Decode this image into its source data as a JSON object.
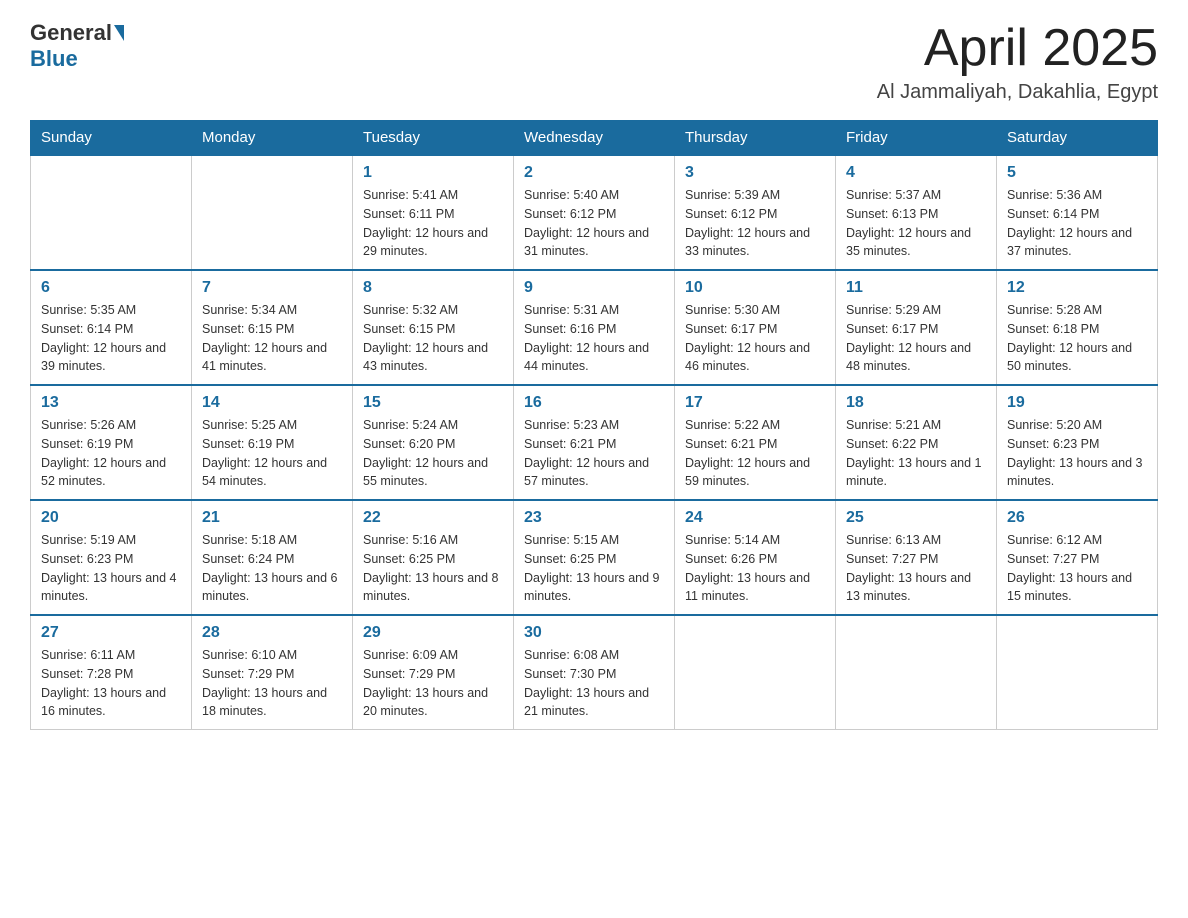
{
  "header": {
    "logo_general": "General",
    "logo_blue": "Blue",
    "month_title": "April 2025",
    "location": "Al Jammaliyah, Dakahlia, Egypt"
  },
  "days_of_week": [
    "Sunday",
    "Monday",
    "Tuesday",
    "Wednesday",
    "Thursday",
    "Friday",
    "Saturday"
  ],
  "weeks": [
    [
      {
        "day": "",
        "sunrise": "",
        "sunset": "",
        "daylight": ""
      },
      {
        "day": "",
        "sunrise": "",
        "sunset": "",
        "daylight": ""
      },
      {
        "day": "1",
        "sunrise": "Sunrise: 5:41 AM",
        "sunset": "Sunset: 6:11 PM",
        "daylight": "Daylight: 12 hours and 29 minutes."
      },
      {
        "day": "2",
        "sunrise": "Sunrise: 5:40 AM",
        "sunset": "Sunset: 6:12 PM",
        "daylight": "Daylight: 12 hours and 31 minutes."
      },
      {
        "day": "3",
        "sunrise": "Sunrise: 5:39 AM",
        "sunset": "Sunset: 6:12 PM",
        "daylight": "Daylight: 12 hours and 33 minutes."
      },
      {
        "day": "4",
        "sunrise": "Sunrise: 5:37 AM",
        "sunset": "Sunset: 6:13 PM",
        "daylight": "Daylight: 12 hours and 35 minutes."
      },
      {
        "day": "5",
        "sunrise": "Sunrise: 5:36 AM",
        "sunset": "Sunset: 6:14 PM",
        "daylight": "Daylight: 12 hours and 37 minutes."
      }
    ],
    [
      {
        "day": "6",
        "sunrise": "Sunrise: 5:35 AM",
        "sunset": "Sunset: 6:14 PM",
        "daylight": "Daylight: 12 hours and 39 minutes."
      },
      {
        "day": "7",
        "sunrise": "Sunrise: 5:34 AM",
        "sunset": "Sunset: 6:15 PM",
        "daylight": "Daylight: 12 hours and 41 minutes."
      },
      {
        "day": "8",
        "sunrise": "Sunrise: 5:32 AM",
        "sunset": "Sunset: 6:15 PM",
        "daylight": "Daylight: 12 hours and 43 minutes."
      },
      {
        "day": "9",
        "sunrise": "Sunrise: 5:31 AM",
        "sunset": "Sunset: 6:16 PM",
        "daylight": "Daylight: 12 hours and 44 minutes."
      },
      {
        "day": "10",
        "sunrise": "Sunrise: 5:30 AM",
        "sunset": "Sunset: 6:17 PM",
        "daylight": "Daylight: 12 hours and 46 minutes."
      },
      {
        "day": "11",
        "sunrise": "Sunrise: 5:29 AM",
        "sunset": "Sunset: 6:17 PM",
        "daylight": "Daylight: 12 hours and 48 minutes."
      },
      {
        "day": "12",
        "sunrise": "Sunrise: 5:28 AM",
        "sunset": "Sunset: 6:18 PM",
        "daylight": "Daylight: 12 hours and 50 minutes."
      }
    ],
    [
      {
        "day": "13",
        "sunrise": "Sunrise: 5:26 AM",
        "sunset": "Sunset: 6:19 PM",
        "daylight": "Daylight: 12 hours and 52 minutes."
      },
      {
        "day": "14",
        "sunrise": "Sunrise: 5:25 AM",
        "sunset": "Sunset: 6:19 PM",
        "daylight": "Daylight: 12 hours and 54 minutes."
      },
      {
        "day": "15",
        "sunrise": "Sunrise: 5:24 AM",
        "sunset": "Sunset: 6:20 PM",
        "daylight": "Daylight: 12 hours and 55 minutes."
      },
      {
        "day": "16",
        "sunrise": "Sunrise: 5:23 AM",
        "sunset": "Sunset: 6:21 PM",
        "daylight": "Daylight: 12 hours and 57 minutes."
      },
      {
        "day": "17",
        "sunrise": "Sunrise: 5:22 AM",
        "sunset": "Sunset: 6:21 PM",
        "daylight": "Daylight: 12 hours and 59 minutes."
      },
      {
        "day": "18",
        "sunrise": "Sunrise: 5:21 AM",
        "sunset": "Sunset: 6:22 PM",
        "daylight": "Daylight: 13 hours and 1 minute."
      },
      {
        "day": "19",
        "sunrise": "Sunrise: 5:20 AM",
        "sunset": "Sunset: 6:23 PM",
        "daylight": "Daylight: 13 hours and 3 minutes."
      }
    ],
    [
      {
        "day": "20",
        "sunrise": "Sunrise: 5:19 AM",
        "sunset": "Sunset: 6:23 PM",
        "daylight": "Daylight: 13 hours and 4 minutes."
      },
      {
        "day": "21",
        "sunrise": "Sunrise: 5:18 AM",
        "sunset": "Sunset: 6:24 PM",
        "daylight": "Daylight: 13 hours and 6 minutes."
      },
      {
        "day": "22",
        "sunrise": "Sunrise: 5:16 AM",
        "sunset": "Sunset: 6:25 PM",
        "daylight": "Daylight: 13 hours and 8 minutes."
      },
      {
        "day": "23",
        "sunrise": "Sunrise: 5:15 AM",
        "sunset": "Sunset: 6:25 PM",
        "daylight": "Daylight: 13 hours and 9 minutes."
      },
      {
        "day": "24",
        "sunrise": "Sunrise: 5:14 AM",
        "sunset": "Sunset: 6:26 PM",
        "daylight": "Daylight: 13 hours and 11 minutes."
      },
      {
        "day": "25",
        "sunrise": "Sunrise: 6:13 AM",
        "sunset": "Sunset: 7:27 PM",
        "daylight": "Daylight: 13 hours and 13 minutes."
      },
      {
        "day": "26",
        "sunrise": "Sunrise: 6:12 AM",
        "sunset": "Sunset: 7:27 PM",
        "daylight": "Daylight: 13 hours and 15 minutes."
      }
    ],
    [
      {
        "day": "27",
        "sunrise": "Sunrise: 6:11 AM",
        "sunset": "Sunset: 7:28 PM",
        "daylight": "Daylight: 13 hours and 16 minutes."
      },
      {
        "day": "28",
        "sunrise": "Sunrise: 6:10 AM",
        "sunset": "Sunset: 7:29 PM",
        "daylight": "Daylight: 13 hours and 18 minutes."
      },
      {
        "day": "29",
        "sunrise": "Sunrise: 6:09 AM",
        "sunset": "Sunset: 7:29 PM",
        "daylight": "Daylight: 13 hours and 20 minutes."
      },
      {
        "day": "30",
        "sunrise": "Sunrise: 6:08 AM",
        "sunset": "Sunset: 7:30 PM",
        "daylight": "Daylight: 13 hours and 21 minutes."
      },
      {
        "day": "",
        "sunrise": "",
        "sunset": "",
        "daylight": ""
      },
      {
        "day": "",
        "sunrise": "",
        "sunset": "",
        "daylight": ""
      },
      {
        "day": "",
        "sunrise": "",
        "sunset": "",
        "daylight": ""
      }
    ]
  ]
}
